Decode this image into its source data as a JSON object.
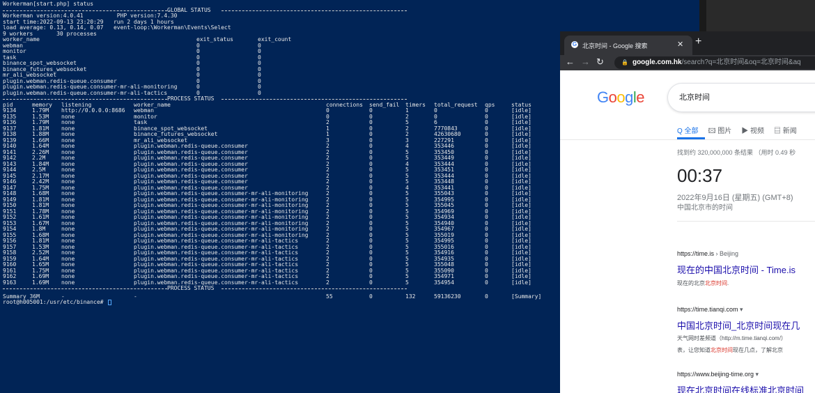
{
  "terminal": {
    "header": "Workerman[start.php] status",
    "global_status_label": "GLOBAL STATUS",
    "process_status_label": "PROCESS STATUS",
    "info_lines": [
      "Workerman version:4.0.41          PHP version:7.4.30",
      "start time:2022-09-13 23:20:29   run 2 days 1 hours",
      "load average: 0.13, 0.14, 0.07   event-loop:\\Workerman\\Events\\Select",
      "9 workers       30 processes"
    ],
    "worker_headers": [
      "worker_name",
      "exit_status",
      "exit_count"
    ],
    "workers": [
      [
        "webman",
        "0",
        "0"
      ],
      [
        "monitor",
        "0",
        "0"
      ],
      [
        "task",
        "0",
        "0"
      ],
      [
        "binance_spot_websocket",
        "0",
        "0"
      ],
      [
        "binance_futures_websocket",
        "0",
        "0"
      ],
      [
        "mr_ali_websocket",
        "0",
        "0"
      ],
      [
        "plugin.webman.redis-queue.consumer",
        "0",
        "0"
      ],
      [
        "plugin.webman.redis-queue.consumer-mr-ali-monitoring",
        "0",
        "0"
      ],
      [
        "plugin.webman.redis-queue.consumer-mr-ali-tactics",
        "0",
        "0"
      ]
    ],
    "process_headers": [
      "pid",
      "memory",
      "listening",
      "worker_name",
      "connections",
      "send_fail",
      "timers",
      "total_request",
      "qps",
      "status"
    ],
    "processes": [
      [
        "9134",
        "1.79M",
        "http://0.0.0.0:8686",
        "webman",
        "0",
        "0",
        "1",
        "0",
        "0",
        "[idle]"
      ],
      [
        "9135",
        "1.53M",
        "none",
        "monitor",
        "0",
        "0",
        "2",
        "0",
        "0",
        "[idle]"
      ],
      [
        "9136",
        "1.79M",
        "none",
        "task",
        "2",
        "0",
        "5",
        "6",
        "0",
        "[idle]"
      ],
      [
        "9137",
        "1.81M",
        "none",
        "binance_spot_websocket",
        "1",
        "0",
        "2",
        "7770843",
        "0",
        "[idle]"
      ],
      [
        "9138",
        "1.88M",
        "none",
        "binance_futures_websocket",
        "1",
        "0",
        "2",
        "42630680",
        "0",
        "[idle]"
      ],
      [
        "9139",
        "1.66M",
        "none",
        "mr_ali_websocket",
        "3",
        "0",
        "3",
        "227291",
        "0",
        "[idle]"
      ],
      [
        "9140",
        "1.64M",
        "none",
        "plugin.webman.redis-queue.consumer",
        "2",
        "0",
        "4",
        "353446",
        "0",
        "[idle]"
      ],
      [
        "9141",
        "2.26M",
        "none",
        "plugin.webman.redis-queue.consumer",
        "2",
        "0",
        "5",
        "353450",
        "0",
        "[idle]"
      ],
      [
        "9142",
        "2.2M",
        "none",
        "plugin.webman.redis-queue.consumer",
        "2",
        "0",
        "5",
        "353449",
        "0",
        "[idle]"
      ],
      [
        "9143",
        "1.84M",
        "none",
        "plugin.webman.redis-queue.consumer",
        "2",
        "0",
        "4",
        "353444",
        "0",
        "[idle]"
      ],
      [
        "9144",
        "2.5M",
        "none",
        "plugin.webman.redis-queue.consumer",
        "2",
        "0",
        "5",
        "353451",
        "0",
        "[idle]"
      ],
      [
        "9145",
        "2.17M",
        "none",
        "plugin.webman.redis-queue.consumer",
        "2",
        "0",
        "5",
        "353444",
        "0",
        "[idle]"
      ],
      [
        "9146",
        "2.42M",
        "none",
        "plugin.webman.redis-queue.consumer",
        "2",
        "0",
        "5",
        "353448",
        "0",
        "[idle]"
      ],
      [
        "9147",
        "1.75M",
        "none",
        "plugin.webman.redis-queue.consumer",
        "2",
        "0",
        "4",
        "353441",
        "0",
        "[idle]"
      ],
      [
        "9148",
        "1.68M",
        "none",
        "plugin.webman.redis-queue.consumer-mr-ali-monitoring",
        "2",
        "0",
        "5",
        "355043",
        "0",
        "[idle]"
      ],
      [
        "9149",
        "1.81M",
        "none",
        "plugin.webman.redis-queue.consumer-mr-ali-monitoring",
        "2",
        "0",
        "5",
        "354995",
        "0",
        "[idle]"
      ],
      [
        "9150",
        "1.81M",
        "none",
        "plugin.webman.redis-queue.consumer-mr-ali-monitoring",
        "2",
        "0",
        "5",
        "355045",
        "0",
        "[idle]"
      ],
      [
        "9151",
        "1.78M",
        "none",
        "plugin.webman.redis-queue.consumer-mr-ali-monitoring",
        "2",
        "0",
        "5",
        "354969",
        "0",
        "[idle]"
      ],
      [
        "9152",
        "1.61M",
        "none",
        "plugin.webman.redis-queue.consumer-mr-ali-monitoring",
        "2",
        "0",
        "5",
        "354934",
        "0",
        "[idle]"
      ],
      [
        "9153",
        "1.67M",
        "none",
        "plugin.webman.redis-queue.consumer-mr-ali-monitoring",
        "2",
        "0",
        "5",
        "354940",
        "0",
        "[idle]"
      ],
      [
        "9154",
        "1.8M",
        "none",
        "plugin.webman.redis-queue.consumer-mr-ali-monitoring",
        "2",
        "0",
        "5",
        "354967",
        "0",
        "[idle]"
      ],
      [
        "9155",
        "1.68M",
        "none",
        "plugin.webman.redis-queue.consumer-mr-ali-monitoring",
        "2",
        "0",
        "5",
        "355019",
        "0",
        "[idle]"
      ],
      [
        "9156",
        "1.81M",
        "none",
        "plugin.webman.redis-queue.consumer-mr-ali-tactics",
        "2",
        "0",
        "5",
        "354995",
        "0",
        "[idle]"
      ],
      [
        "9157",
        "1.53M",
        "none",
        "plugin.webman.redis-queue.consumer-mr-ali-tactics",
        "2",
        "0",
        "5",
        "355016",
        "0",
        "[idle]"
      ],
      [
        "9158",
        "2.52M",
        "none",
        "plugin.webman.redis-queue.consumer-mr-ali-tactics",
        "2",
        "0",
        "5",
        "354916",
        "0",
        "[idle]"
      ],
      [
        "9159",
        "1.64M",
        "none",
        "plugin.webman.redis-queue.consumer-mr-ali-tactics",
        "2",
        "0",
        "5",
        "354935",
        "0",
        "[idle]"
      ],
      [
        "9160",
        "1.65M",
        "none",
        "plugin.webman.redis-queue.consumer-mr-ali-tactics",
        "2",
        "0",
        "5",
        "355048",
        "0",
        "[idle]"
      ],
      [
        "9161",
        "1.75M",
        "none",
        "plugin.webman.redis-queue.consumer-mr-ali-tactics",
        "2",
        "0",
        "5",
        "355090",
        "0",
        "[idle]"
      ],
      [
        "9162",
        "1.69M",
        "none",
        "plugin.webman.redis-queue.consumer-mr-ali-tactics",
        "2",
        "0",
        "5",
        "354971",
        "0",
        "[idle]"
      ],
      [
        "9163",
        "1.69M",
        "none",
        "plugin.webman.redis-queue.consumer-mr-ali-tactics",
        "2",
        "0",
        "5",
        "354954",
        "0",
        "[idle]"
      ]
    ],
    "summary": [
      "Summary 36M",
      "-",
      "-",
      "55",
      "0",
      "132",
      "59136230",
      "0",
      "[Summary]"
    ],
    "prompt": "root@h005001:/usr/etc/binance# "
  },
  "browser": {
    "tab_title": "北京时间 - Google 搜索",
    "new_tab_label": "+",
    "url_domain": "google.com.hk",
    "url_path": "/search?q=北京时间&oq=北京时间&aq",
    "search_query": "北京时间",
    "search_tabs": [
      "Q 全部",
      "🖾 图片",
      "▶ 视频",
      "▤ 新闻"
    ],
    "stats": "找到约 320,000,000 条结果 （用时 0.49 秒",
    "time": "00:37",
    "date": "2022年9月16日 (星期五) (GMT+8)",
    "place": "中国北京市的时间",
    "results": [
      {
        "url": "https://time.is",
        "crumb": " › Beijing",
        "title": "现在的中国北京时间 - Time.is",
        "snip_pre": "现在的北京",
        "snip_hl": "北京时间",
        "snip_post": "."
      },
      {
        "url": "https://time.tianqi.com",
        "crumb": " ▾",
        "title": "中国北京时间_北京时间现在几",
        "snip_pre": "天气网时差频道（http://m.time.tianqi.com/）",
        "snip_hl": "",
        "snip_post": ""
      },
      {
        "url": "https://www.beijing-time.org",
        "crumb": " ▾",
        "title": "现在北京时间在线标准北京时间",
        "snip_pre": "",
        "snip_hl": "",
        "snip_post": ""
      }
    ],
    "result2_line2_pre": "表，让您知道",
    "result2_line2_hl": "北京时间",
    "result2_line2_post": "现在几点，了解北京"
  },
  "colors": {
    "terminal_bg": "#012456",
    "link": "#1a0dab",
    "highlight": "#d93025",
    "google_blue": "#4285f4",
    "google_red": "#ea4335",
    "google_yellow": "#fbbc05",
    "google_green": "#34a853"
  }
}
